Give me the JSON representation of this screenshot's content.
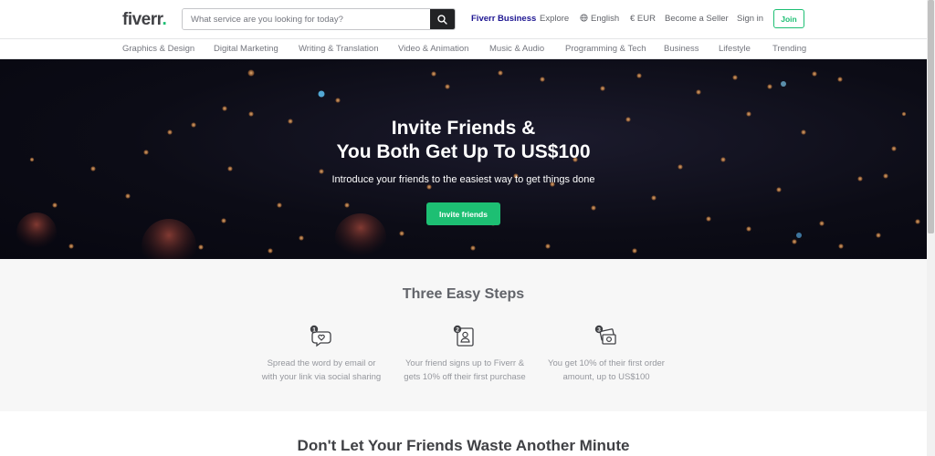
{
  "header": {
    "logo": "fiverr",
    "logo_dot": ".",
    "search_placeholder": "What service are you looking for today?",
    "nav": {
      "business": "Fiverr Business",
      "explore": "Explore",
      "language": "English",
      "currency": "€ EUR",
      "seller": "Become a Seller",
      "signin": "Sign in",
      "join": "Join"
    }
  },
  "categories": [
    "Graphics & Design",
    "Digital Marketing",
    "Writing & Translation",
    "Video & Animation",
    "Music & Audio",
    "Programming & Tech",
    "Business",
    "Lifestyle",
    "Trending"
  ],
  "hero": {
    "title_line1": "Invite Friends &",
    "title_line2": "You Both Get Up To US$100",
    "subtitle": "Introduce your friends to the easiest way to get things done",
    "button": "Invite friends"
  },
  "steps": {
    "title": "Three Easy Steps",
    "items": [
      {
        "number": "1",
        "icon": "speech-heart-icon",
        "text": "Spread the word by email or with your link via social sharing"
      },
      {
        "number": "2",
        "icon": "signup-profile-icon",
        "text": "Your friend signs up to Fiverr & gets 10% off their first purchase"
      },
      {
        "number": "3",
        "icon": "money-reward-icon",
        "text": "You get 10% of their first order amount, up to US$100"
      }
    ]
  },
  "bottom": {
    "title": "Don't Let Your Friends Waste Another Minute"
  },
  "colors": {
    "brand_green": "#1dbf73",
    "business_blue": "#1e1692",
    "dark": "#404145"
  }
}
